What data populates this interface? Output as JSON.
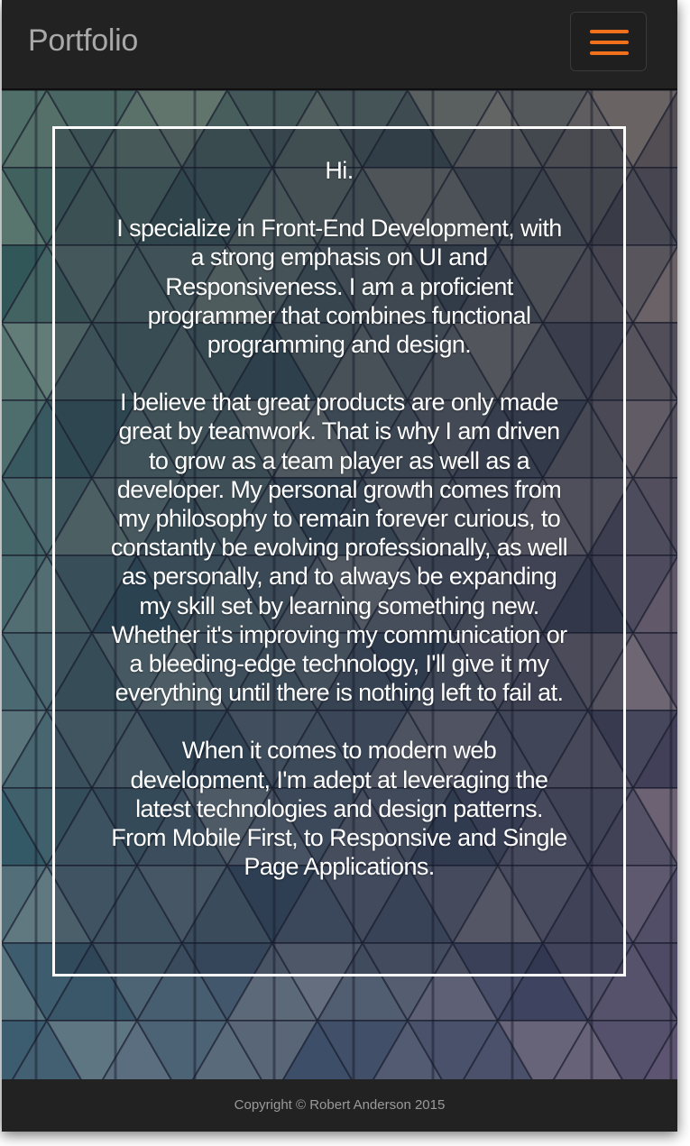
{
  "navbar": {
    "brand": "Portfolio",
    "toggle_icon": "hamburger-menu-icon",
    "toggle_color": "#f0701c"
  },
  "about": {
    "greeting": "Hi.",
    "paragraph_1": "I specialize in Front-End Development, with a strong emphasis on UI and Responsiveness. I am a proficient programmer that combines functional programming and design.",
    "paragraph_2": "I believe that great products are only made great by teamwork. That is why I am driven to grow as a team player as well as a developer. My personal growth comes from my philosophy to remain forever curious, to constantly be evolving professionally, as well as personally, and to always be expanding my skill set by learning something new. Whether it's improving my communication or a bleeding-edge technology, I'll give it my everything until there is nothing left to fail at.",
    "paragraph_3": "When it comes to modern web development, I'm adept at leveraging the latest technologies and design patterns. From Mobile First, to Responsive and Single Page Applications."
  },
  "footer": {
    "copyright": "Copyright © Robert Anderson 2015"
  },
  "colors": {
    "nav_background": "#222222",
    "accent": "#f0701c",
    "text": "#ffffff"
  }
}
